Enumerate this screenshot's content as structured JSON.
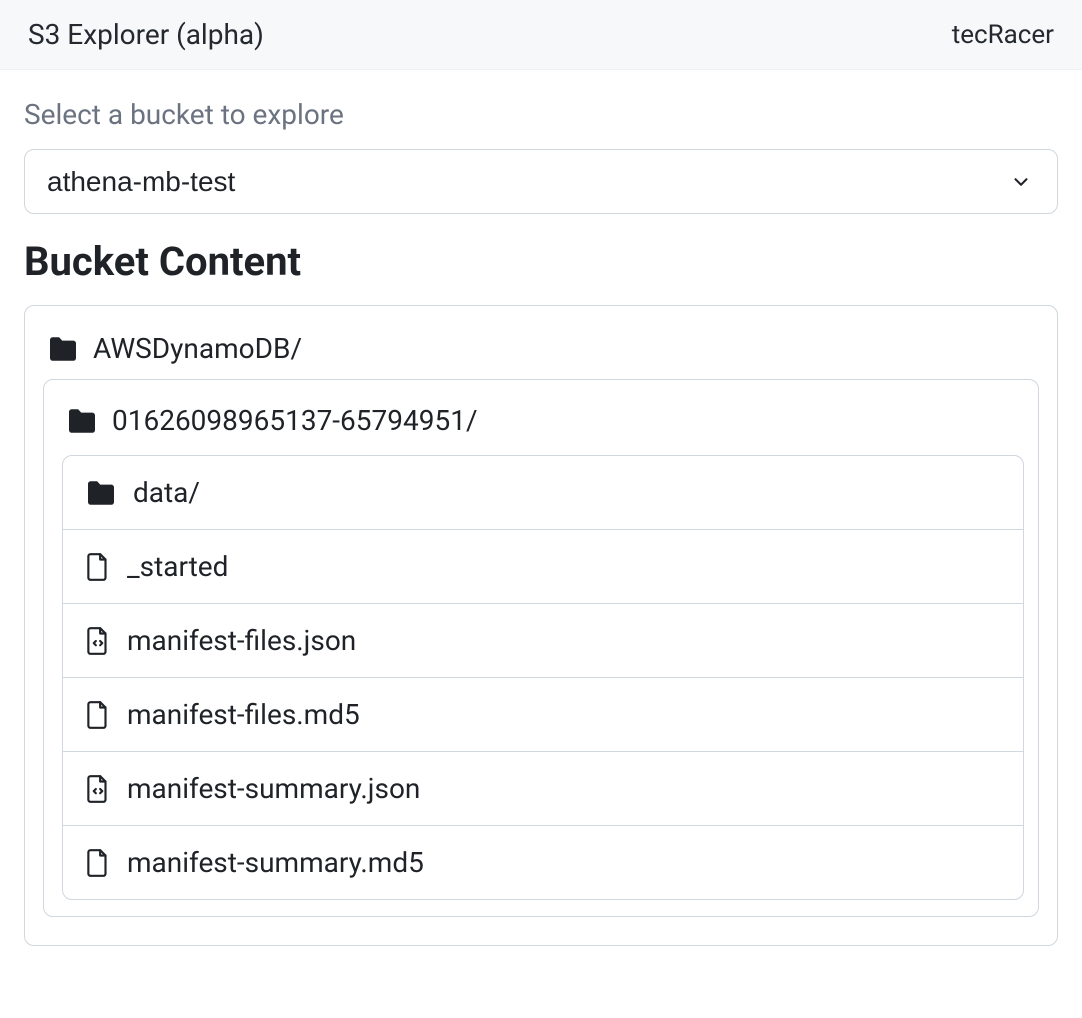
{
  "header": {
    "title": "S3 Explorer (alpha)",
    "brand": "tecRacer"
  },
  "selector": {
    "label": "Select a bucket to explore",
    "value": "athena-mb-test"
  },
  "section": {
    "title": "Bucket Content"
  },
  "tree": {
    "root": {
      "name": "AWSDynamoDB/",
      "icon": "folder"
    },
    "sub": {
      "name": "01626098965137-65794951/",
      "icon": "folder"
    },
    "items": [
      {
        "name": "data/",
        "icon": "folder"
      },
      {
        "name": "_started",
        "icon": "file"
      },
      {
        "name": "manifest-files.json",
        "icon": "code-file"
      },
      {
        "name": "manifest-files.md5",
        "icon": "file"
      },
      {
        "name": "manifest-summary.json",
        "icon": "code-file"
      },
      {
        "name": "manifest-summary.md5",
        "icon": "file"
      }
    ]
  }
}
